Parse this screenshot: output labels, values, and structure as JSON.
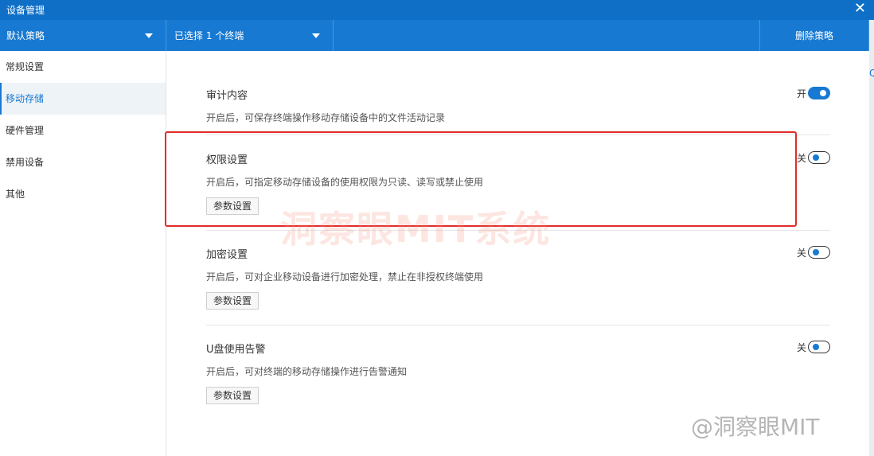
{
  "window": {
    "title": "设备管理"
  },
  "toolbar": {
    "policy_select": "默认策略",
    "terminal_select": "已选择 1 个终端",
    "delete_label": "删除策略"
  },
  "sidebar": {
    "items": [
      {
        "label": "常规设置",
        "active": false
      },
      {
        "label": "移动存储",
        "active": true
      },
      {
        "label": "硬件管理",
        "active": false
      },
      {
        "label": "禁用设备",
        "active": false
      },
      {
        "label": "其他",
        "active": false
      }
    ]
  },
  "settings": [
    {
      "label": "审计内容",
      "description": "开启后，可保存终端操作移动存储设备中的文件活动记录",
      "state_label": "开",
      "enabled": true
    },
    {
      "label": "权限设置",
      "description": "开启后，可指定移动存储设备的使用权限为只读、读写或禁止使用",
      "state_label": "关",
      "enabled": false,
      "button": "参数设置"
    },
    {
      "label": "加密设置",
      "description": "开启后，可对企业移动设备进行加密处理，禁止在非授权终端使用",
      "state_label": "关",
      "enabled": false,
      "button": "参数设置"
    },
    {
      "label": "U盘使用告警",
      "description": "开启后，可对终端的移动存储操作进行告警通知",
      "state_label": "关",
      "enabled": false,
      "button": "参数设置"
    }
  ],
  "watermarks": {
    "center": "洞察眼MIT系统",
    "corner": "@洞察眼MIT"
  },
  "colors": {
    "primary": "#1779d2",
    "titlebar": "#0f6fc6",
    "highlight": "#e22c2c"
  }
}
